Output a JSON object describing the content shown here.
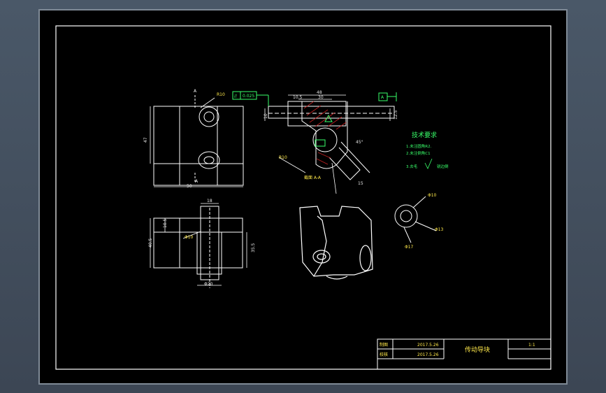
{
  "title_block": {
    "label_drawn": "制图",
    "label_checked": "校核",
    "date_drawn": "2017.5.26",
    "date_checked": "2017.5.26",
    "part_name": "传动导块",
    "scale": "1:1"
  },
  "tech_requirements": {
    "heading": "技术要求",
    "item1": "1.未注圆角R2.",
    "item2": "2.未注倒角C1",
    "item3": "3.去毛",
    "item3_tail": "锐边倒"
  },
  "dimensions": {
    "front_width": "50",
    "front_height": "47",
    "section_top_width": "48",
    "section_inner": "30",
    "section_left": "10.5",
    "section_bottom": "10",
    "section_right": "12.5",
    "section_angle": "45°",
    "section_arc": "R10",
    "section_bottom_right": "15",
    "bottom_top": "18",
    "bottom_left": "10.5",
    "bottom_height": "40.5",
    "bottom_right": "35.5",
    "bottom_dia": "Φ20",
    "bottom_label": "Φ10"
  },
  "annotations": {
    "view_a_top": "A",
    "view_a_bottom": "A",
    "tolerance_symbol": "//",
    "tolerance_value": "0.025",
    "datum": "A",
    "section_label": "截面 A-A",
    "front_hole": "R10",
    "ring_label": "Φ10",
    "ring_label2": "Φ13",
    "ring_label3": "Φ17"
  },
  "colors": {
    "canvas": "#000000",
    "lines": "#ffffff",
    "dims": "#e6e6e6",
    "text_yellow": "#ffe94a",
    "text_green": "#39ff6a",
    "hatch": "#c22020"
  }
}
